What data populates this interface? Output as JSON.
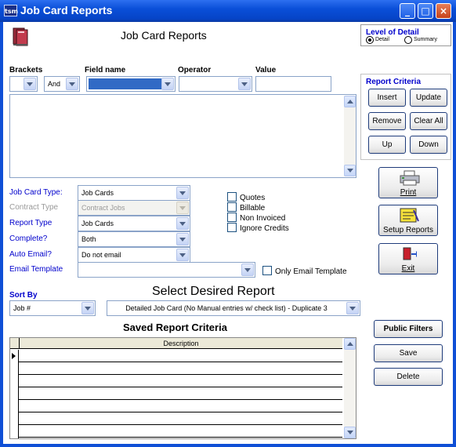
{
  "window": {
    "title": "Job Card Reports",
    "app_badge": "tsm",
    "minimize": "_",
    "maximize": "□",
    "close": "×"
  },
  "header": {
    "title": "Job Card Reports"
  },
  "level_of_detail": {
    "title": "Level of Detail",
    "detail": "Detail",
    "summary": "Summary",
    "selected": "Detail"
  },
  "criteria_headers": {
    "brackets": "Brackets",
    "field_name": "Field name",
    "operator": "Operator",
    "value": "Value"
  },
  "criteria_row": {
    "brackets": "",
    "andor": "And",
    "field_name": "",
    "operator": "",
    "value": ""
  },
  "report_criteria": {
    "title": "Report Criteria",
    "insert": "Insert",
    "update": "Update",
    "remove": "Remove",
    "clear_all": "Clear All",
    "up": "Up",
    "down": "Down"
  },
  "options": {
    "job_card_type": {
      "label": "Job Card Type:",
      "value": "Job Cards"
    },
    "contract_type": {
      "label": "Contract Type",
      "value": "Contract Jobs"
    },
    "report_type": {
      "label": "Report Type",
      "value": "Job Cards"
    },
    "complete": {
      "label": "Complete?",
      "value": "Both"
    },
    "auto_email": {
      "label": "Auto Email?",
      "value": "Do not email"
    },
    "email_template": {
      "label": "Email Template",
      "value": ""
    }
  },
  "checkboxes": {
    "quotes": "Quotes",
    "billable": "Billable",
    "non_invoiced": "Non Invoiced",
    "ignore_credits": "Ignore Credits",
    "only_email_template": "Only Email Template"
  },
  "actions": {
    "print": "Print",
    "setup_reports": "Setup Reports",
    "exit": "Exit"
  },
  "sort": {
    "label": "Sort By",
    "value": "Job #"
  },
  "report_select": {
    "title": "Select Desired Report",
    "value": "Detailed Job Card (No Manual entries w/ check list) - Duplicate 3"
  },
  "saved": {
    "title": "Saved Report Criteria",
    "column_description": "Description",
    "public_filters": "Public Filters",
    "save": "Save",
    "delete": "Delete"
  }
}
